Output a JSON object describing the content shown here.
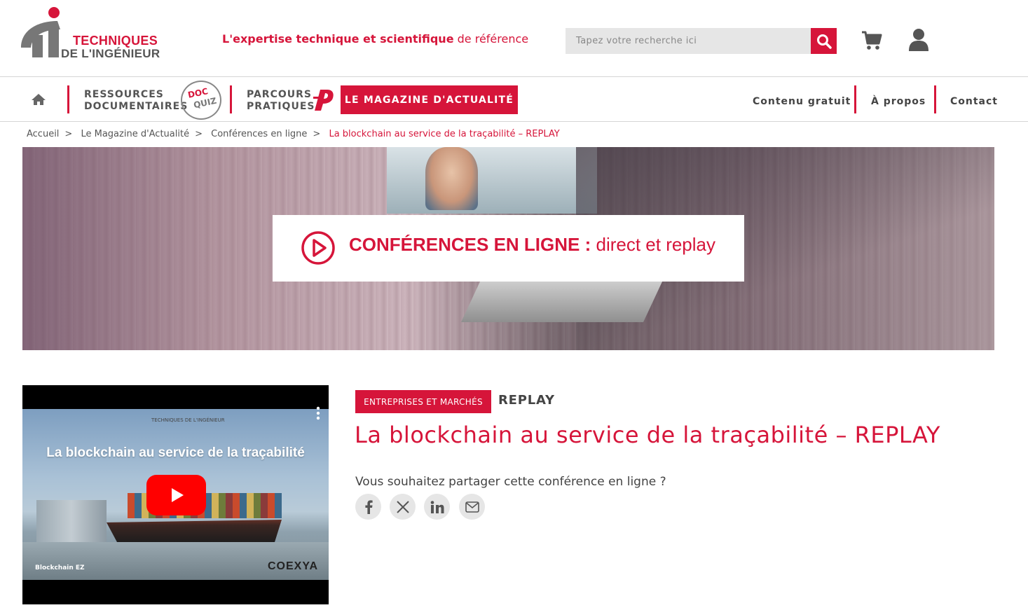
{
  "header": {
    "logo_line1": "TECHNIQUES",
    "logo_line2": "DE L'INGÉNIEUR",
    "tagline_bold": "L'expertise technique et scientifique",
    "tagline_rest": "de référence",
    "search_placeholder": "Tapez votre recherche ici"
  },
  "nav": {
    "ressources_line1": "RESSOURCES",
    "ressources_line2": "DOCUMENTAIRES",
    "docquiz_1": "DOC",
    "docquiz_2": "QUIZ",
    "parcours_line1": "PARCOURS",
    "parcours_line2": "PRATIQUES",
    "magazine": "LE MAGAZINE D'ACTUALITÉ",
    "right_links": [
      "Contenu gratuit",
      "À propos",
      "Contact"
    ]
  },
  "breadcrumb": {
    "items": [
      "Accueil",
      "Le Magazine d'Actualité",
      "Conférences en ligne"
    ],
    "separator": ">",
    "current": "La blockchain au service de la traçabilité – REPLAY"
  },
  "hero": {
    "title_bold": "CONFÉRENCES EN LIGNE :",
    "title_light": "direct et replay"
  },
  "video": {
    "title": "La blockchain au service de la traçabilité",
    "logo": "TECHNIQUES DE L'INGÉNIEUR",
    "badge": "Blockchain EZ",
    "brand": "COEXYA"
  },
  "article": {
    "category": "ENTREPRISES ET MARCHÉS",
    "tag": "REPLAY",
    "title": "La blockchain au service de la traçabilité – REPLAY",
    "share_prompt": "Vous souhaitez partager cette conférence en ligne ?",
    "share_icons": [
      "facebook-icon",
      "x-icon",
      "linkedin-icon",
      "email-icon"
    ]
  },
  "colors": {
    "brand_red": "#d6153a",
    "grey_text": "#555555"
  }
}
